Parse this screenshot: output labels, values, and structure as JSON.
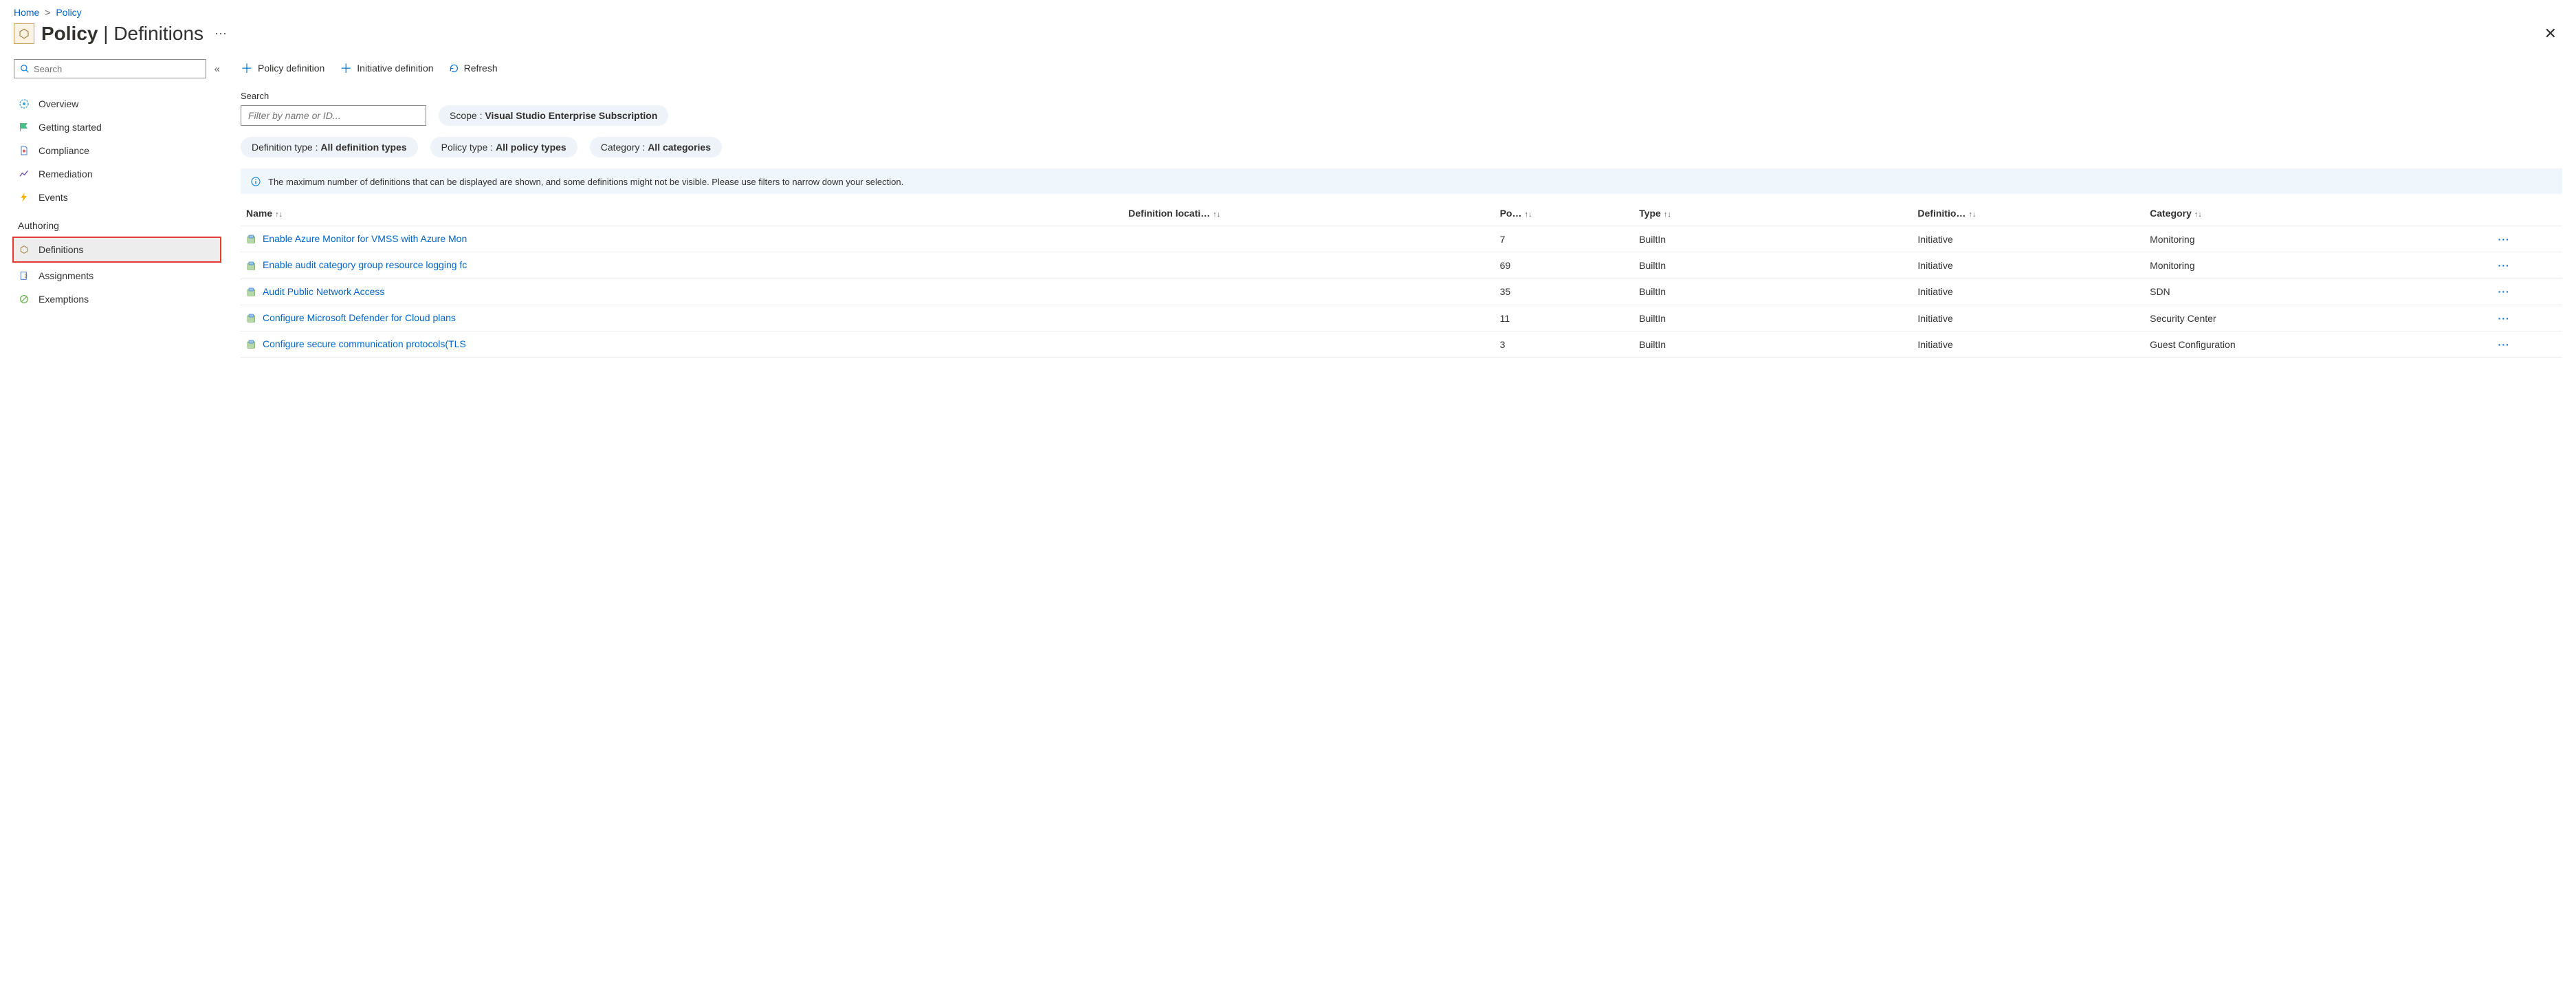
{
  "breadcrumb": {
    "home": "Home",
    "policy": "Policy"
  },
  "header": {
    "bold": "Policy",
    "rest": " | Definitions"
  },
  "sidebar": {
    "search_placeholder": "Search",
    "items": [
      {
        "label": "Overview"
      },
      {
        "label": "Getting started"
      },
      {
        "label": "Compliance"
      },
      {
        "label": "Remediation"
      },
      {
        "label": "Events"
      }
    ],
    "section": "Authoring",
    "authoring": [
      {
        "label": "Definitions",
        "selected": true,
        "highlight": true
      },
      {
        "label": "Assignments"
      },
      {
        "label": "Exemptions"
      }
    ]
  },
  "toolbar": {
    "policy_def": "Policy definition",
    "initiative_def": "Initiative definition",
    "refresh": "Refresh"
  },
  "filters": {
    "search_label": "Search",
    "search_placeholder": "Filter by name or ID...",
    "scope_label": "Scope : ",
    "scope_value": "Visual Studio Enterprise Subscription",
    "deftype_label": "Definition type : ",
    "deftype_value": "All definition types",
    "poltype_label": "Policy type : ",
    "poltype_value": "All policy types",
    "category_label": "Category : ",
    "category_value": "All categories"
  },
  "info": "The maximum number of definitions that can be displayed are shown, and some definitions might not be visible. Please use filters to narrow down your selection.",
  "table": {
    "cols": {
      "name": "Name",
      "loc": "Definition locati…",
      "pol": "Po…",
      "type": "Type",
      "def": "Definitio…",
      "cat": "Category"
    },
    "rows": [
      {
        "name": "Enable Azure Monitor for VMSS with Azure Mon",
        "pol": "7",
        "type": "BuiltIn",
        "def": "Initiative",
        "cat": "Monitoring"
      },
      {
        "name": "Enable audit category group resource logging fc",
        "pol": "69",
        "type": "BuiltIn",
        "def": "Initiative",
        "cat": "Monitoring"
      },
      {
        "name": "Audit Public Network Access",
        "pol": "35",
        "type": "BuiltIn",
        "def": "Initiative",
        "cat": "SDN"
      },
      {
        "name": "Configure Microsoft Defender for Cloud plans",
        "pol": "11",
        "type": "BuiltIn",
        "def": "Initiative",
        "cat": "Security Center"
      },
      {
        "name": "Configure secure communication protocols(TLS",
        "pol": "3",
        "type": "BuiltIn",
        "def": "Initiative",
        "cat": "Guest Configuration"
      }
    ]
  }
}
